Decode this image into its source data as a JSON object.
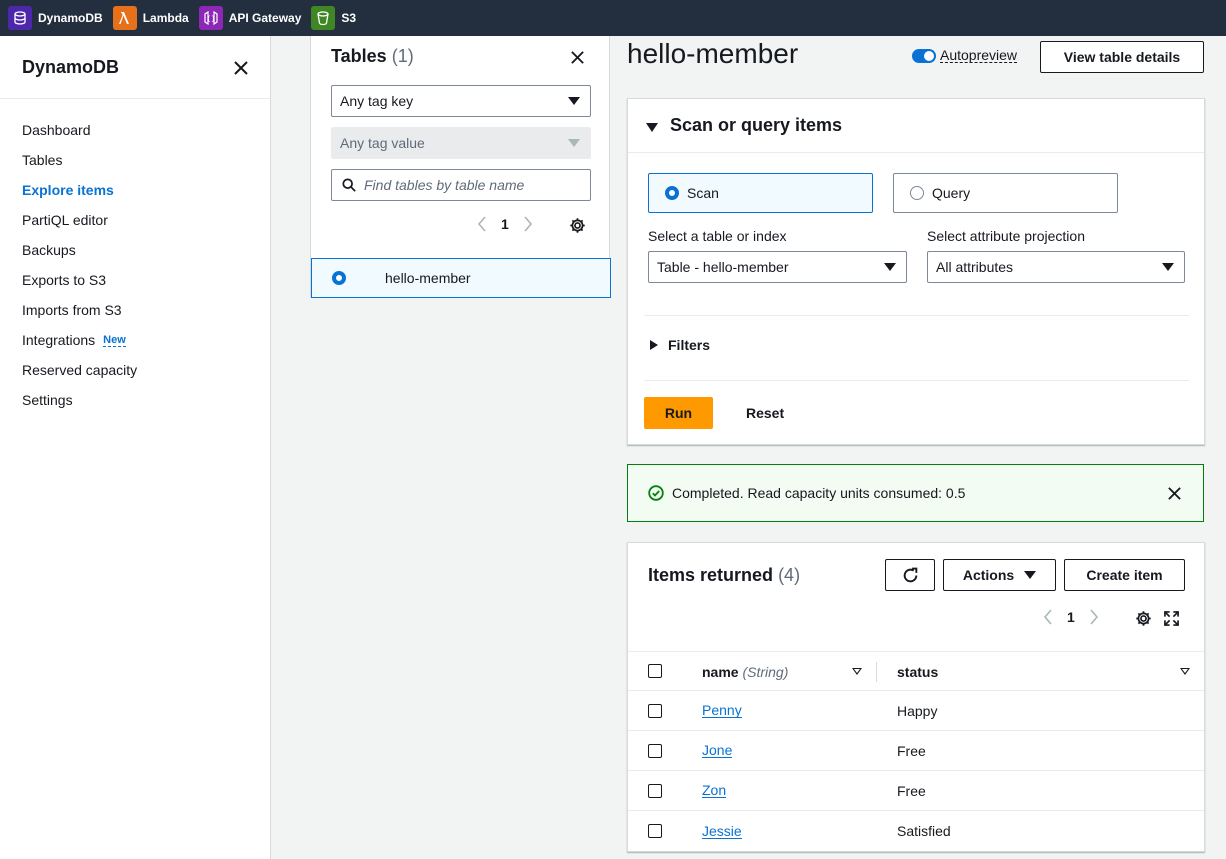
{
  "topbar": {
    "favorites": [
      {
        "label": "DynamoDB",
        "icon": "dynamodb-icon",
        "color": "#4d27aa"
      },
      {
        "label": "Lambda",
        "icon": "lambda-icon",
        "color": "#e7711b"
      },
      {
        "label": "API Gateway",
        "icon": "api-gateway-icon",
        "color": "#8c27b6"
      },
      {
        "label": "S3",
        "icon": "s3-icon",
        "color": "#3f8624"
      }
    ]
  },
  "sidebar": {
    "title": "DynamoDB",
    "items": [
      {
        "label": "Dashboard"
      },
      {
        "label": "Tables"
      },
      {
        "label": "Explore items",
        "active": true
      },
      {
        "label": "PartiQL editor"
      },
      {
        "label": "Backups"
      },
      {
        "label": "Exports to S3"
      },
      {
        "label": "Imports from S3"
      },
      {
        "label": "Integrations",
        "badge": "New"
      },
      {
        "label": "Reserved capacity"
      },
      {
        "label": "Settings"
      }
    ]
  },
  "tables_panel": {
    "title": "Tables",
    "count": "(1)",
    "tag_key": "Any tag key",
    "tag_value": "Any tag value",
    "search_placeholder": "Find tables by table name",
    "page": "1",
    "tables": [
      {
        "name": "hello-member",
        "selected": true
      }
    ]
  },
  "main": {
    "title": "hello-member",
    "autopreview_label": "Autopreview",
    "view_details_label": "View table details",
    "scan_section": {
      "title": "Scan or query items",
      "scan_label": "Scan",
      "query_label": "Query",
      "table_index_label": "Select a table or index",
      "table_index_value": "Table - hello-member",
      "projection_label": "Select attribute projection",
      "projection_value": "All attributes",
      "filters_label": "Filters",
      "run_label": "Run",
      "reset_label": "Reset"
    },
    "flash": {
      "message": "Completed. Read capacity units consumed: 0.5"
    },
    "items": {
      "title": "Items returned",
      "count": "(4)",
      "actions_label": "Actions",
      "create_label": "Create item",
      "page": "1",
      "columns": {
        "name": "name",
        "name_type": "(String)",
        "status": "status"
      },
      "rows": [
        {
          "name": "Penny",
          "status": "Happy"
        },
        {
          "name": "Jone",
          "status": "Free"
        },
        {
          "name": "Zon",
          "status": "Free"
        },
        {
          "name": "Jessie",
          "status": "Satisfied"
        }
      ]
    }
  },
  "colors": {
    "accent": "#0972d3",
    "run_button": "#ff9900",
    "success": "#037f0c",
    "topbar": "#232f3e"
  }
}
